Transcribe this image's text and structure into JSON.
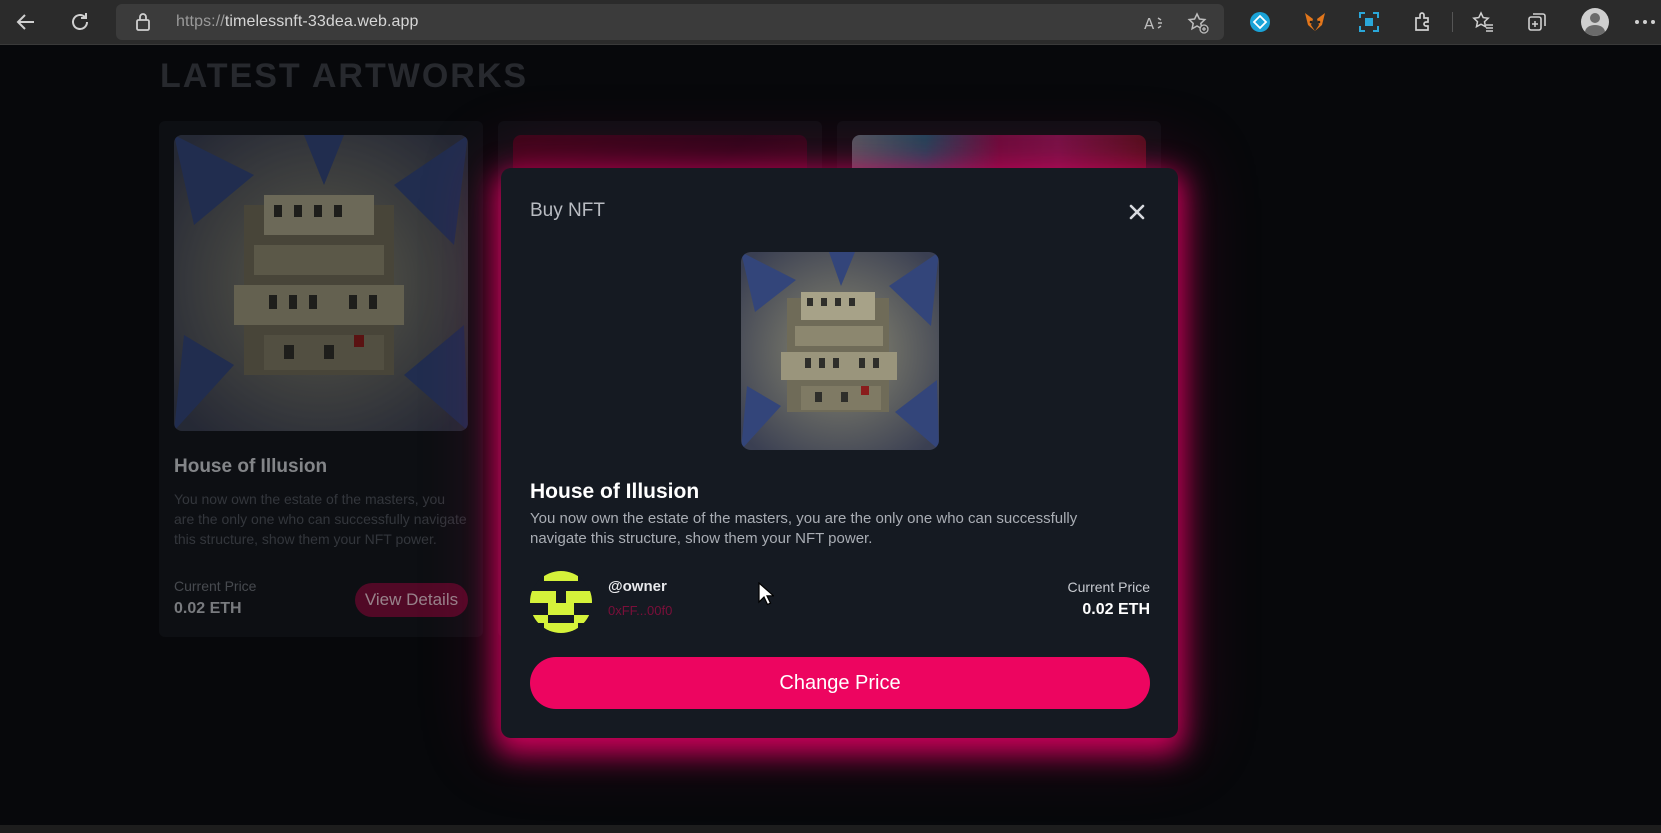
{
  "browser": {
    "url_scheme": "https://",
    "url_host": "timelessnft-33dea.web.app",
    "toolbar_icons": [
      "back-icon",
      "refresh-icon",
      "lock-icon",
      "read-aloud-icon",
      "add-favorite-icon",
      "extension-icon",
      "metamask-icon",
      "screenshot-icon",
      "extensions-icon",
      "favorites-icon",
      "collections-icon",
      "profile-icon",
      "more-icon"
    ]
  },
  "page": {
    "section_title": "LATEST ARTWORKS",
    "cards": [
      {
        "name": "House of Illusion",
        "description": "You now own the estate of the masters, you are the only one who can successfully navigate this structure, show them your NFT power.",
        "price_label": "Current Price",
        "price": "0.02 ETH",
        "button": "View Details"
      }
    ]
  },
  "modal": {
    "title": "Buy NFT",
    "nft_name": "House of Illusion",
    "nft_description": "You now own the estate of the masters, you are the only one who can successfully navigate this structure, show them your NFT power.",
    "owner_handle": "@owner",
    "owner_address": "0xFF...00f0",
    "price_label": "Current Price",
    "price": "0.02 ETH",
    "action_button": "Change Price"
  },
  "colors": {
    "accent": "#ed0560",
    "modal_bg": "#151a22",
    "page_bg": "#0b0d11",
    "owner_avatar": "#d5f23a"
  }
}
